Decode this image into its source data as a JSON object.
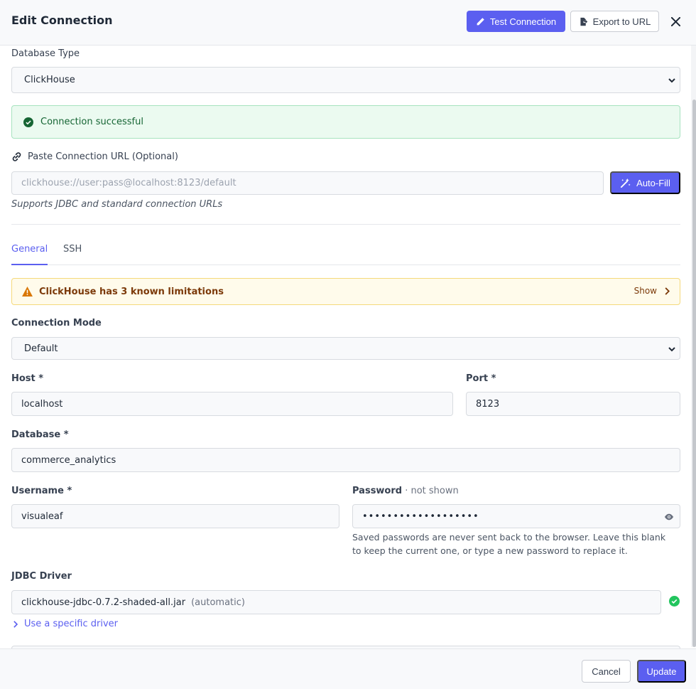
{
  "header": {
    "title": "Edit Connection",
    "test_connection_label": "Test Connection",
    "export_label": "Export to URL"
  },
  "database_type": {
    "label": "Database Type",
    "value": "ClickHouse"
  },
  "status": {
    "message": "Connection successful"
  },
  "paste_url": {
    "label": "Paste Connection URL (Optional)",
    "placeholder": "clickhouse://user:pass@localhost:8123/default",
    "autofill_label": "Auto-Fill",
    "hint": "Supports JDBC and standard connection URLs"
  },
  "tabs": [
    {
      "label": "General",
      "active": true
    },
    {
      "label": "SSH",
      "active": false
    }
  ],
  "warning": {
    "text": "ClickHouse has 3 known limitations",
    "show_label": "Show"
  },
  "connection_mode": {
    "label": "Connection Mode",
    "value": "Default"
  },
  "host": {
    "label": "Host *",
    "value": "localhost"
  },
  "port": {
    "label": "Port *",
    "value": "8123"
  },
  "database": {
    "label": "Database *",
    "value": "commerce_analytics"
  },
  "username": {
    "label": "Username *",
    "value": "visualeaf"
  },
  "password": {
    "label": "Password",
    "status": " · not shown",
    "masked_value": "•••••••••••••••••••",
    "note": "Saved passwords are never sent back to the browser. Leave this blank to keep the current one, or type a new password to replace it."
  },
  "jdbc_driver": {
    "label": "JDBC Driver",
    "value": "clickhouse-jdbc-0.7.2-shaded-all.jar",
    "mode": "(automatic)",
    "specific_link": "Use a specific driver"
  },
  "footer": {
    "cancel_label": "Cancel",
    "update_label": "Update"
  },
  "colors": {
    "accent": "#5b5ff0",
    "success": "#16a34a",
    "warning": "#d97706"
  },
  "icons": [
    "pencil-icon",
    "export-icon",
    "close-icon",
    "check-circle-icon",
    "link-icon",
    "magic-wand-icon",
    "warning-icon",
    "chevron-right-icon",
    "eye-icon",
    "chevron-down-icon"
  ]
}
